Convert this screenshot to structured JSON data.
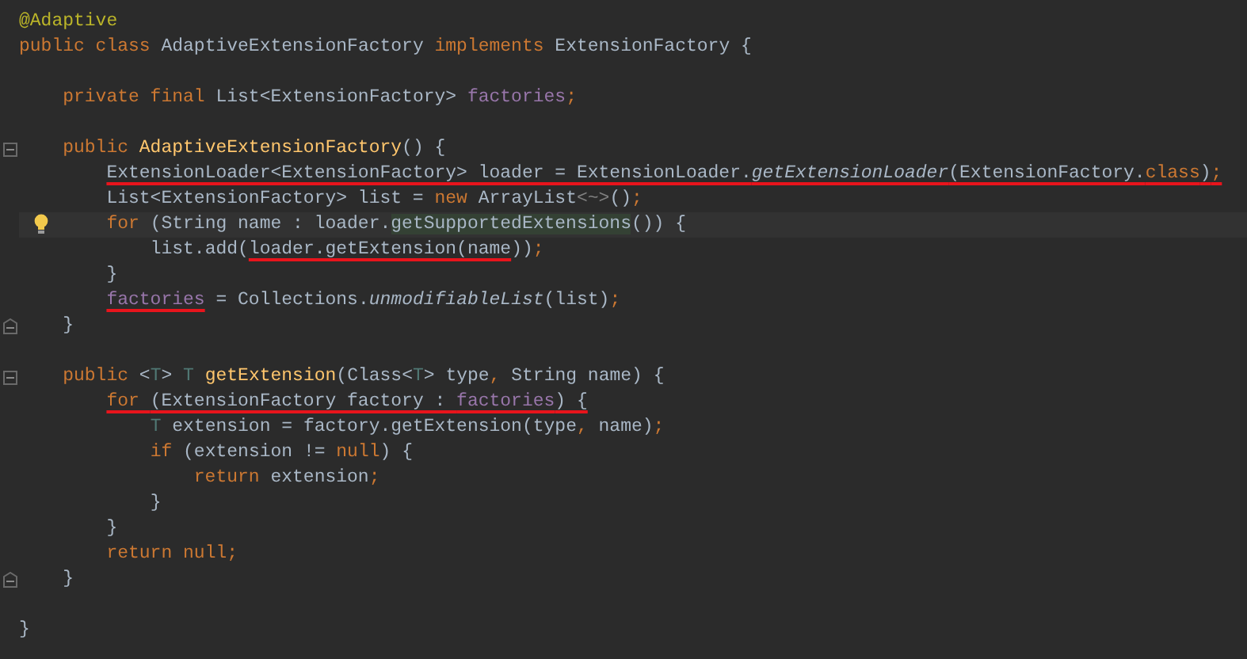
{
  "editor": {
    "lines": [
      {
        "kind": "code",
        "tokens": [
          {
            "text": "@Adaptive",
            "kind": "annotation"
          }
        ]
      },
      {
        "kind": "code",
        "tokens": [
          {
            "text": "public class ",
            "kind": "keyword"
          },
          {
            "text": "AdaptiveExtensionFactory ",
            "kind": "plain"
          },
          {
            "text": "implements ",
            "kind": "keyword"
          },
          {
            "text": "ExtensionFactory {",
            "kind": "plain"
          }
        ],
        "children": [
          {
            "kind": "code"
          },
          {
            "kind": "code",
            "tokens": [
              {
                "text": "private final ",
                "kind": "keyword"
              },
              {
                "text": "List<ExtensionFactory> ",
                "kind": "plain"
              },
              {
                "text": "factories",
                "kind": "field"
              },
              {
                "text": ";",
                "kind": "keyword"
              }
            ]
          },
          {
            "kind": "code"
          },
          {
            "kind": "fold-start",
            "tokens": [
              {
                "text": "public ",
                "kind": "keyword"
              },
              {
                "text": "AdaptiveExtensionFactory",
                "kind": "method"
              },
              {
                "text": "() {",
                "kind": "plain"
              }
            ],
            "children": [
              {
                "kind": "code",
                "tokens": [
                  {
                    "kind": "underlined",
                    "tokens": [
                      {
                        "text": "ExtensionLoader<ExtensionFactory> loader = ExtensionLoader.",
                        "kind": "plain"
                      },
                      {
                        "text": "getExtensionLoader",
                        "kind": "static"
                      },
                      {
                        "text": "(ExtensionFactory.",
                        "kind": "plain"
                      },
                      {
                        "text": "class",
                        "kind": "keyword"
                      },
                      {
                        "text": ")",
                        "kind": "plain"
                      },
                      {
                        "text": ";",
                        "kind": "keyword"
                      }
                    ]
                  }
                ]
              },
              {
                "kind": "code",
                "tokens": [
                  {
                    "text": "List<ExtensionFactory> list = ",
                    "kind": "plain"
                  },
                  {
                    "text": "new ",
                    "kind": "keyword"
                  },
                  {
                    "text": "ArrayList",
                    "kind": "plain"
                  },
                  {
                    "text": "<~>",
                    "kind": "generic"
                  },
                  {
                    "text": "()",
                    "kind": "plain"
                  },
                  {
                    "text": ";",
                    "kind": "keyword"
                  }
                ]
              },
              {
                "kind": "bulb",
                "current": true,
                "tokens": [
                  {
                    "text": "for ",
                    "kind": "keyword"
                  },
                  {
                    "text": "(String name : loader.",
                    "kind": "plain"
                  },
                  {
                    "text": "getSupportedExtensions",
                    "kind": "highlight"
                  },
                  {
                    "text": "()) {",
                    "kind": "plain"
                  }
                ],
                "children": [
                  {
                    "kind": "code",
                    "tokens": [
                      {
                        "text": "list.add(",
                        "kind": "plain"
                      },
                      {
                        "kind": "underlined",
                        "tokens": [
                          {
                            "text": "loader.getExtension(name",
                            "kind": "plain"
                          }
                        ]
                      },
                      {
                        "text": "))",
                        "kind": "plain"
                      },
                      {
                        "text": ";",
                        "kind": "keyword"
                      }
                    ]
                  }
                ]
              },
              {
                "kind": "code",
                "tokens": [
                  {
                    "text": "}",
                    "kind": "plain"
                  }
                ]
              },
              {
                "kind": "code",
                "tokens": [
                  {
                    "kind": "underlined",
                    "tokens": [
                      {
                        "text": "factories",
                        "kind": "field"
                      }
                    ]
                  },
                  {
                    "text": " = Collections.",
                    "kind": "plain"
                  },
                  {
                    "text": "unmodifiableList",
                    "kind": "static"
                  },
                  {
                    "text": "(list)",
                    "kind": "plain"
                  },
                  {
                    "text": ";",
                    "kind": "keyword"
                  }
                ]
              }
            ]
          },
          {
            "kind": "fold-end",
            "tokens": [
              {
                "text": "}",
                "kind": "plain"
              }
            ]
          },
          {
            "kind": "code"
          },
          {
            "kind": "fold-start",
            "tokens": [
              {
                "text": "public ",
                "kind": "keyword"
              },
              {
                "text": "<",
                "kind": "plain"
              },
              {
                "text": "T",
                "kind": "type-param"
              },
              {
                "text": "> ",
                "kind": "plain"
              },
              {
                "text": "T ",
                "kind": "type-param"
              },
              {
                "text": "getExtension",
                "kind": "method"
              },
              {
                "text": "(Class<",
                "kind": "plain"
              },
              {
                "text": "T",
                "kind": "type-param"
              },
              {
                "text": "> type",
                "kind": "plain"
              },
              {
                "text": ", ",
                "kind": "keyword"
              },
              {
                "text": "String name) {",
                "kind": "plain"
              }
            ],
            "children": [
              {
                "kind": "code",
                "tokens": [
                  {
                    "kind": "underlined",
                    "tokens": [
                      {
                        "text": "for ",
                        "kind": "keyword"
                      },
                      {
                        "text": "(ExtensionFactory factory : ",
                        "kind": "plain"
                      },
                      {
                        "text": "factories",
                        "kind": "field"
                      },
                      {
                        "text": ") {",
                        "kind": "plain"
                      }
                    ]
                  }
                ],
                "children": [
                  {
                    "kind": "code",
                    "tokens": [
                      {
                        "text": "T ",
                        "kind": "type-param"
                      },
                      {
                        "text": "extension = factory.getExtension(type",
                        "kind": "plain"
                      },
                      {
                        "text": ", ",
                        "kind": "keyword"
                      },
                      {
                        "text": "name)",
                        "kind": "plain"
                      },
                      {
                        "text": ";",
                        "kind": "keyword"
                      }
                    ]
                  },
                  {
                    "kind": "code",
                    "tokens": [
                      {
                        "text": "if ",
                        "kind": "keyword"
                      },
                      {
                        "text": "(extension != ",
                        "kind": "plain"
                      },
                      {
                        "text": "null",
                        "kind": "keyword"
                      },
                      {
                        "text": ") {",
                        "kind": "plain"
                      }
                    ],
                    "children": [
                      {
                        "kind": "code",
                        "tokens": [
                          {
                            "text": "return ",
                            "kind": "keyword"
                          },
                          {
                            "text": "extension",
                            "kind": "plain"
                          },
                          {
                            "text": ";",
                            "kind": "keyword"
                          }
                        ]
                      }
                    ]
                  },
                  {
                    "kind": "code",
                    "tokens": [
                      {
                        "text": "}",
                        "kind": "plain"
                      }
                    ]
                  }
                ]
              },
              {
                "kind": "code",
                "tokens": [
                  {
                    "text": "}",
                    "kind": "plain"
                  }
                ]
              },
              {
                "kind": "code",
                "tokens": [
                  {
                    "text": "return null",
                    "kind": "keyword"
                  },
                  {
                    "text": ";",
                    "kind": "keyword"
                  }
                ]
              }
            ]
          },
          {
            "kind": "fold-end",
            "tokens": [
              {
                "text": "}",
                "kind": "plain"
              }
            ]
          },
          {
            "kind": "code"
          }
        ]
      },
      {
        "kind": "code",
        "tokens": [
          {
            "text": "}",
            "kind": "plain"
          }
        ]
      }
    ]
  }
}
